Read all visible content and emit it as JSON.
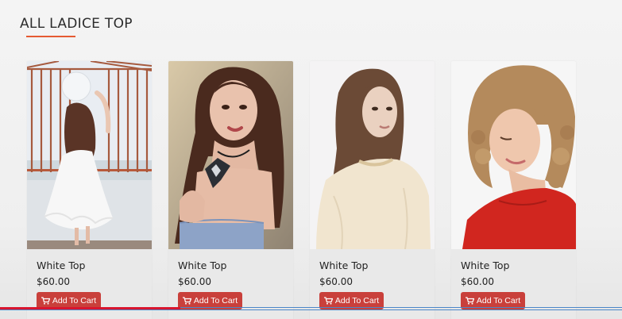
{
  "section": {
    "title": "ALL LADICE TOP",
    "underline_color": "#e55a32"
  },
  "products": [
    {
      "title": "White Top",
      "price": "$60.00",
      "button_label": "Add To Cart",
      "image": "woman in white dress holding balloon on balcony"
    },
    {
      "title": "White Top",
      "price": "$60.00",
      "button_label": "Add To Cart",
      "image": "woman in blue top with black statement necklace"
    },
    {
      "title": "White Top",
      "price": "$60.00",
      "button_label": "Add To Cart",
      "image": "woman in sheer cream blouse looking over shoulder"
    },
    {
      "title": "White Top",
      "price": "$60.00",
      "button_label": "Add To Cart",
      "image": "curly haired woman in red top"
    }
  ],
  "cart_button_color": "#c9403b",
  "cart_icon": "shopping-cart-icon",
  "video_progress": {
    "played_fraction": 0.29,
    "played_color": "#d8152e",
    "track_color": "#4a86c8"
  }
}
